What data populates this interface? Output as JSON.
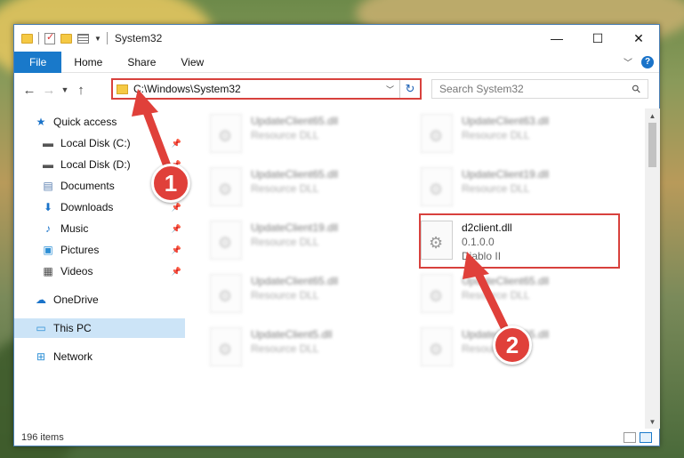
{
  "window": {
    "title": "System32",
    "controls": {
      "minimize": "—",
      "maximize": "☐",
      "close": "✕"
    }
  },
  "ribbon": {
    "tabs": [
      "File",
      "Home",
      "Share",
      "View"
    ],
    "help": "?"
  },
  "address": {
    "path": "C:\\Windows\\System32",
    "search_placeholder": "Search System32"
  },
  "sidebar": {
    "items": [
      {
        "label": "Quick access",
        "icon": "star-icon",
        "pinned": false
      },
      {
        "label": "Local Disk (C:)",
        "icon": "drive-icon",
        "pinned": true
      },
      {
        "label": "Local Disk (D:)",
        "icon": "drive-icon",
        "pinned": true
      },
      {
        "label": "Documents",
        "icon": "documents-icon",
        "pinned": true
      },
      {
        "label": "Downloads",
        "icon": "download-icon",
        "pinned": true
      },
      {
        "label": "Music",
        "icon": "music-icon",
        "pinned": true
      },
      {
        "label": "Pictures",
        "icon": "pictures-icon",
        "pinned": true
      },
      {
        "label": "Videos",
        "icon": "videos-icon",
        "pinned": true
      },
      {
        "label": "OneDrive",
        "icon": "cloud-icon",
        "pinned": false
      },
      {
        "label": "This PC",
        "icon": "computer-icon",
        "pinned": false,
        "selected": true
      },
      {
        "label": "Network",
        "icon": "network-icon",
        "pinned": false
      }
    ]
  },
  "files": [
    {
      "name": "UpdateClient65.dll",
      "desc": "Resource DLL",
      "blurred": true
    },
    {
      "name": "UpdateClient63.dll",
      "desc": "Resource DLL",
      "blurred": true
    },
    {
      "name": "UpdateClient65.dll",
      "desc": "Resource DLL",
      "blurred": true
    },
    {
      "name": "UpdateClient19.dll",
      "desc": "Resource DLL",
      "blurred": true
    },
    {
      "name": "UpdateClient19.dll",
      "desc": "Resource DLL",
      "blurred": true
    },
    {
      "name": "d2client.dll",
      "desc": "0.1.0.0",
      "desc2": "Diablo II",
      "blurred": false
    },
    {
      "name": "UpdateClient65.dll",
      "desc": "Resource DLL",
      "blurred": true
    },
    {
      "name": "UpdateClient65.dll",
      "desc": "Resource DLL",
      "blurred": true
    },
    {
      "name": "UpdateClient5.dll",
      "desc": "Resource DLL",
      "blurred": true
    },
    {
      "name": "UpdateClient65.dll",
      "desc": "Resource DLL",
      "blurred": true
    }
  ],
  "status": {
    "count": "196 items"
  },
  "annotations": {
    "badge1": "1",
    "badge2": "2",
    "color": "#e0403a"
  }
}
